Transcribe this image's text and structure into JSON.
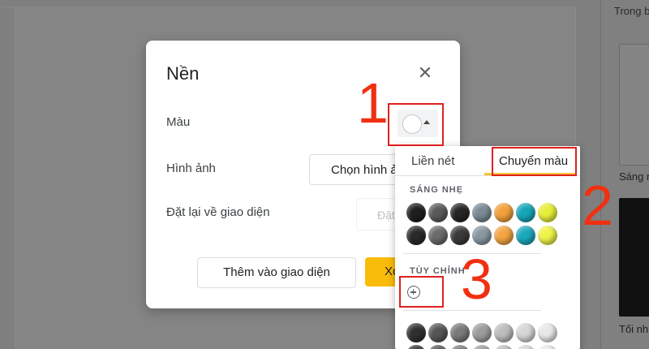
{
  "right_panel": {
    "title": "Trong b",
    "thumb1_label": "Sáng n",
    "thumb2_label": "Tối nh"
  },
  "dialog": {
    "title": "Nền",
    "close_icon": "close-icon",
    "color_label": "Màu",
    "image_label": "Hình ảnh",
    "choose_image_button": "Chọn hình ả",
    "reset_label": "Đặt lại về giao diện",
    "reset_button": "Đặt",
    "add_to_theme_button": "Thêm vào giao diện",
    "done_button": "Xo",
    "current_color": "#ffffff"
  },
  "dropdown": {
    "tabs": [
      {
        "label": "Liền nét",
        "active": false
      },
      {
        "label": "Chuyển màu",
        "active": true
      }
    ],
    "light_label": "SÁNG NHẸ",
    "custom_label": "TÙY CHỈNH",
    "add_custom_icon": "plus-circle-icon",
    "light_row1": [
      "#1e1e1e",
      "#5a5a5a",
      "#262626",
      "#7a8a94",
      "#f2a13c",
      "#16a6b8",
      "#e8ef3a"
    ],
    "light_row2": [
      "#2a2a2a",
      "#6a6a6a",
      "#3a3a3a",
      "#8a96a0",
      "#f4a443",
      "#1aa8bc",
      "#eef447"
    ],
    "gray_row": [
      "#303030",
      "#555555",
      "#7a7a7a",
      "#9c9c9c",
      "#bdbdbd",
      "#d6d6d6",
      "#e8e8e8"
    ]
  },
  "annotations": {
    "n1": "1",
    "n2": "2",
    "n3": "3",
    "color": "#e02020"
  }
}
